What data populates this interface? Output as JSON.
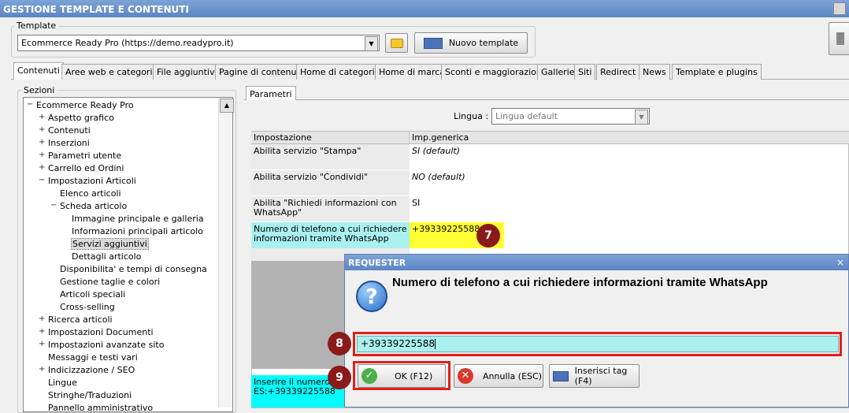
{
  "window": {
    "title": "GESTIONE TEMPLATE E CONTENUTI"
  },
  "template_group": {
    "legend": "Template",
    "selected": "Ecommerce Ready Pro (https://demo.readypro.it)",
    "new_button": "Nuovo template"
  },
  "tabs": [
    "Contenuti",
    "Aree web e categorie",
    "File aggiuntivi",
    "Pagine di contenuti",
    "Home di categoria",
    "Home di marca",
    "Sconti e maggiorazioni",
    "Gallerie",
    "Siti",
    "Redirect",
    "News",
    "Template e plugins"
  ],
  "sections": {
    "legend": "Sezioni",
    "tree": [
      {
        "label": "Ecommerce Ready Pro",
        "level": 0,
        "expander": "−"
      },
      {
        "label": "Aspetto grafico",
        "level": 1,
        "expander": "+"
      },
      {
        "label": "Contenuti",
        "level": 1,
        "expander": "+"
      },
      {
        "label": "Inserzioni",
        "level": 1,
        "expander": "+"
      },
      {
        "label": "Parametri utente",
        "level": 1,
        "expander": "+"
      },
      {
        "label": "Carrello ed Ordini",
        "level": 1,
        "expander": "+"
      },
      {
        "label": "Impostazioni Articoli",
        "level": 1,
        "expander": "−"
      },
      {
        "label": "Elenco articoli",
        "level": 2,
        "expander": ""
      },
      {
        "label": "Scheda articolo",
        "level": 2,
        "expander": "−"
      },
      {
        "label": "Immagine principale e galleria",
        "level": 3,
        "expander": ""
      },
      {
        "label": "Informazioni principali articolo",
        "level": 3,
        "expander": ""
      },
      {
        "label": "Servizi aggiuntivi",
        "level": 3,
        "expander": "",
        "selected": true
      },
      {
        "label": "Dettagli articolo",
        "level": 3,
        "expander": ""
      },
      {
        "label": "Disponibilita' e tempi di consegna",
        "level": 2,
        "expander": ""
      },
      {
        "label": "Gestione taglie e colori",
        "level": 2,
        "expander": ""
      },
      {
        "label": "Articoli speciali",
        "level": 2,
        "expander": ""
      },
      {
        "label": "Cross-selling",
        "level": 2,
        "expander": ""
      },
      {
        "label": "Ricerca articoli",
        "level": 1,
        "expander": "+"
      },
      {
        "label": "Impostazioni Documenti",
        "level": 1,
        "expander": "+"
      },
      {
        "label": "Impostazioni avanzate sito",
        "level": 1,
        "expander": "+"
      },
      {
        "label": "Messaggi e testi vari",
        "level": 1,
        "expander": ""
      },
      {
        "label": "Indicizzazione / SEO",
        "level": 1,
        "expander": "+"
      },
      {
        "label": "Lingue",
        "level": 1,
        "expander": ""
      },
      {
        "label": "Stringhe/Traduzioni",
        "level": 1,
        "expander": ""
      },
      {
        "label": "Pannello amministrativo",
        "level": 1,
        "expander": ""
      }
    ]
  },
  "params": {
    "tab": "Parametri",
    "lingua_label": "Lingua :",
    "lingua_value": "Lingua default",
    "col_setting": "Impostazione",
    "col_value": "Imp.generica",
    "rows": [
      {
        "setting": "Abilita servizio \"Stampa\"",
        "value": "SI (default)"
      },
      {
        "setting": "Abilita servizio \"Condividi\"",
        "value": "NO (default)"
      },
      {
        "setting": "Abilita \"Richiedi informazioni con WhatsApp\"",
        "value": "SI"
      },
      {
        "setting": "Numero di telefono a cui richiedere informazioni tramite WhatsApp",
        "value": "+39339225588"
      }
    ],
    "hint": "Inserire il numero di ES:+39339225588"
  },
  "dialog": {
    "title": "REQUESTER",
    "question": "Numero di telefono a cui richiedere informazioni tramite WhatsApp",
    "input_value": "+39339225588",
    "ok": "OK (F12)",
    "cancel": "Annulla (ESC)",
    "insert_tag": "Inserisci tag (F4)"
  },
  "markers": [
    "7",
    "8",
    "9"
  ],
  "colors": {
    "highlight_yellow": "#ffff33",
    "cyan": "#aaf0f0",
    "hint_cyan": "#00ffff",
    "marker": "#8b1a1a",
    "red_box": "#e0201b"
  }
}
